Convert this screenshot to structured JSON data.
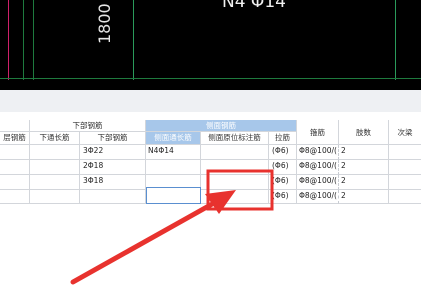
{
  "cad": {
    "label_vertical": "1800",
    "label_top": "N4 Φ14"
  },
  "table": {
    "headers": {
      "col0": "层钢筋",
      "bottom_group": "下部钢筋",
      "bottom_through": "下通长筋",
      "bottom_bar": "下部钢筋",
      "side_group": "侧面钢筋",
      "side_through": "侧面通长筋",
      "side_original": "侧面原位标注筋",
      "tie": "拉筋",
      "stirrup": "箍筋",
      "legs": "肢数",
      "secondary": "次梁"
    },
    "rows": [
      {
        "bottom_bar": "3Φ22",
        "side_through": "N4Φ14",
        "side_original": "",
        "tie": "(Φ6)",
        "stirrup": "Φ8@100/(",
        "legs": "2"
      },
      {
        "bottom_bar": "2Φ18",
        "side_through": "",
        "side_original": "",
        "tie": "(Φ6)",
        "stirrup": "Φ8@100/(",
        "legs": "2"
      },
      {
        "bottom_bar": "3Φ18",
        "side_through": "",
        "side_original": "",
        "tie": "(Φ6)",
        "stirrup": "Φ8@100/(",
        "legs": "2"
      },
      {
        "bottom_bar": "",
        "side_through": "",
        "side_original": "",
        "tie": "(Φ6)",
        "stirrup": "Φ8@100/(",
        "legs": "2"
      }
    ]
  },
  "colors": {
    "cad_background": "#000000",
    "header_accent": "#a7c7ea",
    "annotation_red": "#e8322e"
  }
}
